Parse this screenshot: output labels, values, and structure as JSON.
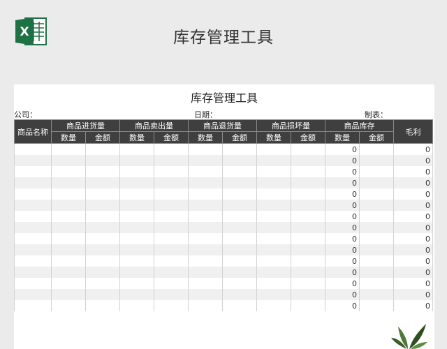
{
  "header": {
    "app_icon": "excel-icon",
    "app_icon_letter": "X",
    "title": "库存管理工具"
  },
  "sheet": {
    "title": "库存管理工具",
    "company_label": "公司：",
    "date_label": "日期：",
    "maker_label": "制表：",
    "columns": {
      "name": "商品名称",
      "in": "商品进货量",
      "sold": "商品卖出量",
      "returned": "商品退货量",
      "damaged": "商品损坏量",
      "stock": "商品库存",
      "profit": "毛利"
    },
    "sub": {
      "qty": "数量",
      "amount": "金额"
    },
    "rows": [
      {
        "stock_qty": "0",
        "profit": "0"
      },
      {
        "stock_qty": "0",
        "profit": "0"
      },
      {
        "stock_qty": "0",
        "profit": "0"
      },
      {
        "stock_qty": "0",
        "profit": "0"
      },
      {
        "stock_qty": "0",
        "profit": "0"
      },
      {
        "stock_qty": "0",
        "profit": "0"
      },
      {
        "stock_qty": "0",
        "profit": "0"
      },
      {
        "stock_qty": "0",
        "profit": "0"
      },
      {
        "stock_qty": "0",
        "profit": "0"
      },
      {
        "stock_qty": "0",
        "profit": "0"
      },
      {
        "stock_qty": "0",
        "profit": "0"
      },
      {
        "stock_qty": "0",
        "profit": "0"
      },
      {
        "stock_qty": "0",
        "profit": "0"
      },
      {
        "stock_qty": "0",
        "profit": "0"
      },
      {
        "stock_qty": "0",
        "profit": "0"
      }
    ]
  },
  "decoration": {
    "plant_icon": "plant-icon"
  },
  "colors": {
    "background": "#ebebeb",
    "header_bar": "#3f3f3f",
    "excel_green": "#1e7145",
    "stripe": "#f0f0f0"
  }
}
